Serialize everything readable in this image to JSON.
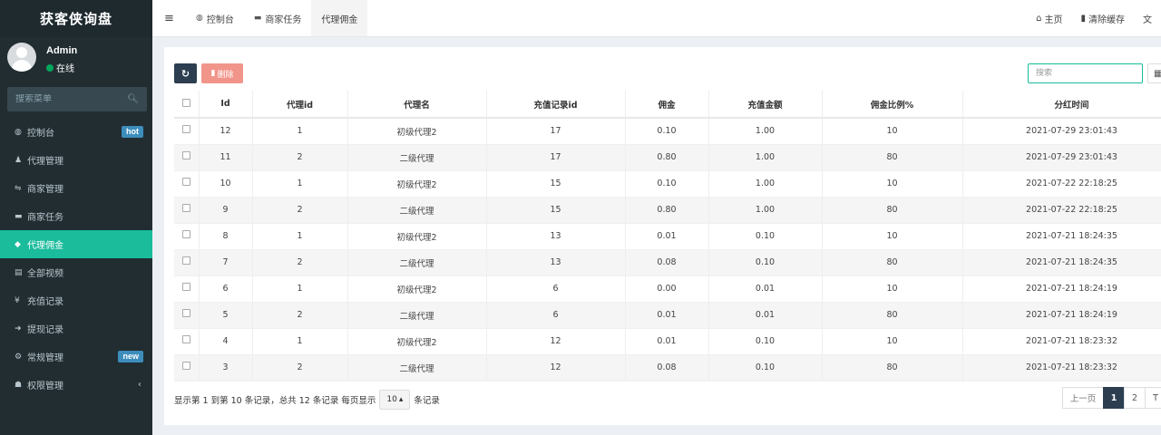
{
  "sidebar": {
    "logo": "获客侠询盘",
    "user": {
      "name": "Admin",
      "status": "在线"
    },
    "search_placeholder": "搜索菜单",
    "items": [
      {
        "icon": "dashboard-icon",
        "glyph": "◍",
        "label": "控制台",
        "badge": "hot"
      },
      {
        "icon": "users-icon",
        "glyph": "♟",
        "label": "代理管理"
      },
      {
        "icon": "handshake-icon",
        "glyph": "⇋",
        "label": "商家管理"
      },
      {
        "icon": "keyboard-icon",
        "glyph": "▬",
        "label": "商家任务"
      },
      {
        "icon": "diamond-icon",
        "glyph": "◆",
        "label": "代理佣金"
      },
      {
        "icon": "file-video-icon",
        "glyph": "▤",
        "label": "全部视频"
      },
      {
        "icon": "yen-icon",
        "glyph": "¥",
        "label": "充值记录"
      },
      {
        "icon": "sign-in-icon",
        "glyph": "➜",
        "label": "提现记录"
      },
      {
        "icon": "cogs-icon",
        "glyph": "⚙",
        "label": "常规管理",
        "badge": "new"
      },
      {
        "icon": "group-icon",
        "glyph": "☗",
        "label": "权限管理",
        "chevron": "‹"
      }
    ]
  },
  "topnav": {
    "menu_glyph": "≡",
    "tabs": [
      {
        "icon": "dashboard-icon",
        "glyph": "◍",
        "label": "控制台"
      },
      {
        "icon": "keyboard-icon",
        "glyph": "▬",
        "label": "商家任务"
      },
      {
        "icon": "",
        "glyph": "",
        "label": "代理佣金"
      }
    ],
    "right": [
      {
        "icon": "home-icon",
        "glyph": "⌂",
        "label": "主页"
      },
      {
        "icon": "trash-icon",
        "glyph": "▮",
        "label": "清除缓存"
      },
      {
        "icon": "language-icon",
        "glyph": "文",
        "label": ""
      }
    ]
  },
  "toolbar": {
    "refresh_glyph": "↻",
    "delete_label": "删除",
    "delete_glyph": "▮",
    "search_placeholder": "搜索",
    "columns_glyph": "▦"
  },
  "table": {
    "columns": [
      "Id",
      "代理id",
      "代理名",
      "充值记录id",
      "佣金",
      "充值金额",
      "佣金比例%",
      "分红时间"
    ],
    "rows": [
      [
        "12",
        "1",
        "初级代理2",
        "17",
        "0.10",
        "1.00",
        "10",
        "2021-07-29 23:01:43"
      ],
      [
        "11",
        "2",
        "二级代理",
        "17",
        "0.80",
        "1.00",
        "80",
        "2021-07-29 23:01:43"
      ],
      [
        "10",
        "1",
        "初级代理2",
        "15",
        "0.10",
        "1.00",
        "10",
        "2021-07-22 22:18:25"
      ],
      [
        "9",
        "2",
        "二级代理",
        "15",
        "0.80",
        "1.00",
        "80",
        "2021-07-22 22:18:25"
      ],
      [
        "8",
        "1",
        "初级代理2",
        "13",
        "0.01",
        "0.10",
        "10",
        "2021-07-21 18:24:35"
      ],
      [
        "7",
        "2",
        "二级代理",
        "13",
        "0.08",
        "0.10",
        "80",
        "2021-07-21 18:24:35"
      ],
      [
        "6",
        "1",
        "初级代理2",
        "6",
        "0.00",
        "0.01",
        "10",
        "2021-07-21 18:24:19"
      ],
      [
        "5",
        "2",
        "二级代理",
        "6",
        "0.01",
        "0.01",
        "80",
        "2021-07-21 18:24:19"
      ],
      [
        "4",
        "1",
        "初级代理2",
        "12",
        "0.01",
        "0.10",
        "10",
        "2021-07-21 18:23:32"
      ],
      [
        "3",
        "2",
        "二级代理",
        "12",
        "0.08",
        "0.10",
        "80",
        "2021-07-21 18:23:32"
      ]
    ]
  },
  "footer": {
    "info_prefix": "显示第 1 到第 10 条记录，总共 12 条记录 每页显示",
    "page_size": "10",
    "page_size_caret": "▴",
    "info_suffix": "条记录",
    "prev": "上一页",
    "pages": [
      "1",
      "2"
    ],
    "current_page": "1",
    "next_partial": "T"
  },
  "colors": {
    "sidebar_bg": "#222d32",
    "accent": "#1abc9c",
    "primary_dark": "#2c3e50",
    "danger_light": "#f1958b",
    "badge_blue": "#3c8dbc"
  }
}
